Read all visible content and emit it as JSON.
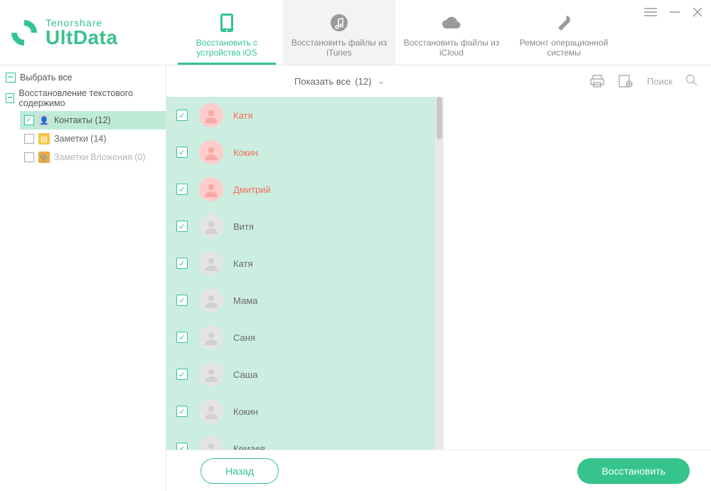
{
  "brand": {
    "top": "Tenorshare",
    "bottom": "UltData"
  },
  "tabs": [
    {
      "label": "Восстановить с устройства iOS",
      "active": true
    },
    {
      "label": "Восстановить файлы из iTunes",
      "active": false
    },
    {
      "label": "Восстановить файлы из iCloud",
      "active": false
    },
    {
      "label": "Ремонт операционной системы",
      "active": false
    }
  ],
  "sidebar": {
    "select_all": "Выбрать все",
    "group_label": "Восстановление текстового содержимо",
    "items": [
      {
        "label": "Контакты (12)",
        "checked": true,
        "active": true,
        "icon": "contacts"
      },
      {
        "label": "Заметки (14)",
        "checked": false,
        "active": false,
        "icon": "notes"
      },
      {
        "label": "Заметки Вложения (0)",
        "checked": false,
        "active": false,
        "icon": "attach",
        "dim": true
      }
    ]
  },
  "toolbar": {
    "filter_label": "Показать все",
    "filter_count": "(12)",
    "search_placeholder": "Поиск"
  },
  "contacts": [
    {
      "name": "Катя",
      "deleted": true
    },
    {
      "name": "Кокин",
      "deleted": true
    },
    {
      "name": "Дмитрий",
      "deleted": true
    },
    {
      "name": "Витя",
      "deleted": false
    },
    {
      "name": "Катя",
      "deleted": false
    },
    {
      "name": "Мама",
      "deleted": false
    },
    {
      "name": "Саня",
      "deleted": false
    },
    {
      "name": "Саша",
      "deleted": false
    },
    {
      "name": "Кокин",
      "deleted": false
    },
    {
      "name": "Кемаев",
      "deleted": false
    }
  ],
  "footer": {
    "back": "Назад",
    "recover": "Восстановить"
  }
}
